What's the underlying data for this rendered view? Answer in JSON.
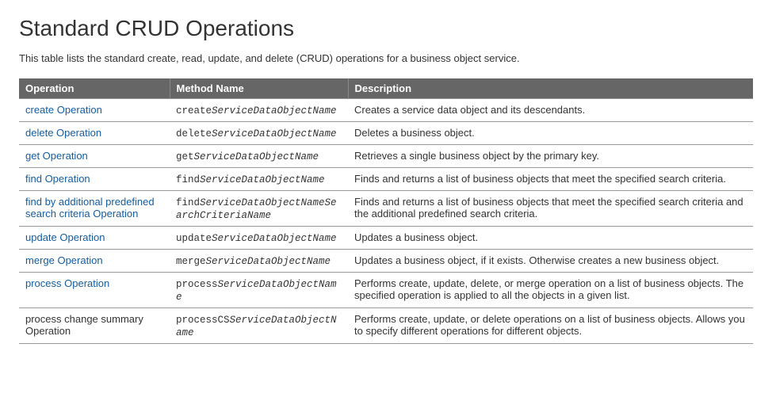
{
  "title": "Standard CRUD Operations",
  "intro": "This table lists the standard create, read, update, and delete (CRUD) operations for a business object service.",
  "headers": {
    "operation": "Operation",
    "method": "Method Name",
    "description": "Description"
  },
  "rows": [
    {
      "operation": "create Operation",
      "operation_link": true,
      "method_prefix": "create",
      "method_italic": "ServiceDataObjectName",
      "description": "Creates a service data object and its descendants."
    },
    {
      "operation": "delete Operation",
      "operation_link": true,
      "method_prefix": "delete",
      "method_italic": "ServiceDataObjectName",
      "description": "Deletes a business object."
    },
    {
      "operation": "get Operation",
      "operation_link": true,
      "method_prefix": "get",
      "method_italic": "ServiceDataObjectName",
      "description": "Retrieves a single business object by the primary key."
    },
    {
      "operation": "find Operation",
      "operation_link": true,
      "method_prefix": "find",
      "method_italic": "ServiceDataObjectName",
      "description": "Finds and returns a list of business objects that meet the specified search criteria."
    },
    {
      "operation": "find by additional predefined search criteria Operation",
      "operation_link": true,
      "method_prefix": "find",
      "method_italic": "ServiceDataObjectNameSearchCriteriaName",
      "description": "Finds and returns a list of business objects that meet the specified search criteria and the additional predefined search criteria."
    },
    {
      "operation": "update Operation",
      "operation_link": true,
      "method_prefix": "update",
      "method_italic": "ServiceDataObjectName",
      "description": "Updates a business object."
    },
    {
      "operation": "merge Operation",
      "operation_link": true,
      "method_prefix": "merge",
      "method_italic": "ServiceDataObjectName",
      "description": "Updates a business object, if it exists. Otherwise creates a new business object."
    },
    {
      "operation": "process Operation",
      "operation_link": true,
      "method_prefix": "process",
      "method_italic": "ServiceDataObjectName",
      "description": "Performs create, update, delete, or merge operation on a list of business objects. The specified operation is applied to all the objects in a given list."
    },
    {
      "operation": "process change summary Operation",
      "operation_link": false,
      "method_prefix": "processCS",
      "method_italic": "ServiceDataObjectName",
      "description": "Performs create, update, or delete operations on a list of business objects. Allows you to specify different operations for different objects."
    }
  ]
}
